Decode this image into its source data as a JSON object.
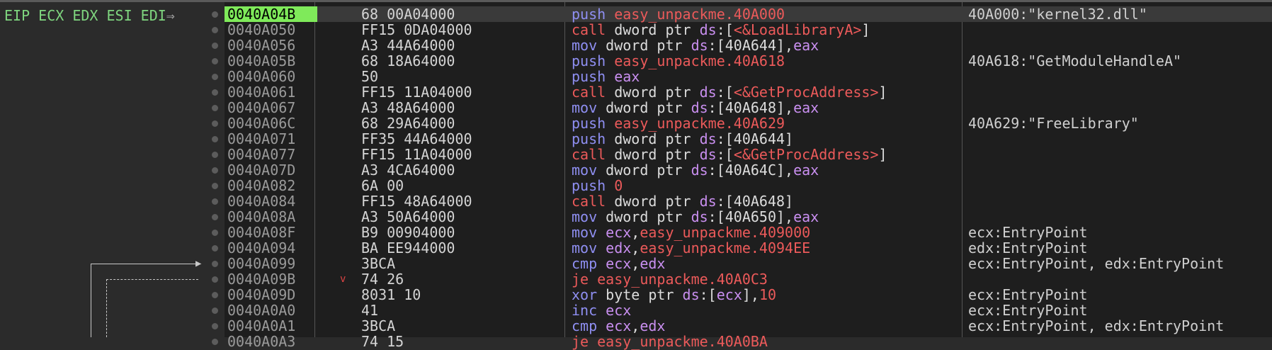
{
  "registers_label": "EIP ECX EDX ESI EDI",
  "eip_arrow": "⇒",
  "rows": [
    {
      "addr": "0040A04B",
      "bytes": "68 00A04000",
      "asm": [
        [
          "push",
          "blue"
        ],
        [
          " ",
          ""
        ],
        [
          "easy_unpackme.40A000",
          "red"
        ]
      ],
      "comment": "40A000:\"kernel32.dll\"",
      "selected": true
    },
    {
      "addr": "0040A050",
      "bytes": "FF15 0DA04000",
      "asm": [
        [
          "call",
          "call"
        ],
        [
          " dword ptr ",
          ""
        ],
        [
          "ds",
          "reg"
        ],
        [
          ":[",
          ""
        ],
        [
          "<&LoadLibraryA>",
          "red"
        ],
        [
          "]",
          ""
        ]
      ],
      "comment": ""
    },
    {
      "addr": "0040A056",
      "bytes": "A3 44A64000",
      "asm": [
        [
          "mov",
          "blue"
        ],
        [
          " dword ptr ",
          ""
        ],
        [
          "ds",
          "reg"
        ],
        [
          ":[40A644],",
          ""
        ],
        [
          "eax",
          "reg"
        ]
      ],
      "comment": ""
    },
    {
      "addr": "0040A05B",
      "bytes": "68 18A64000",
      "asm": [
        [
          "push",
          "blue"
        ],
        [
          " ",
          ""
        ],
        [
          "easy_unpackme.40A618",
          "red"
        ]
      ],
      "comment": "40A618:\"GetModuleHandleA\""
    },
    {
      "addr": "0040A060",
      "bytes": "50",
      "asm": [
        [
          "push",
          "blue"
        ],
        [
          " ",
          ""
        ],
        [
          "eax",
          "reg"
        ]
      ],
      "comment": ""
    },
    {
      "addr": "0040A061",
      "bytes": "FF15 11A04000",
      "asm": [
        [
          "call",
          "call"
        ],
        [
          " dword ptr ",
          ""
        ],
        [
          "ds",
          "reg"
        ],
        [
          ":[",
          ""
        ],
        [
          "<&GetProcAddress>",
          "red"
        ],
        [
          "]",
          ""
        ]
      ],
      "comment": ""
    },
    {
      "addr": "0040A067",
      "bytes": "A3 48A64000",
      "asm": [
        [
          "mov",
          "blue"
        ],
        [
          " dword ptr ",
          ""
        ],
        [
          "ds",
          "reg"
        ],
        [
          ":[40A648],",
          ""
        ],
        [
          "eax",
          "reg"
        ]
      ],
      "comment": ""
    },
    {
      "addr": "0040A06C",
      "bytes": "68 29A64000",
      "asm": [
        [
          "push",
          "blue"
        ],
        [
          " ",
          ""
        ],
        [
          "easy_unpackme.40A629",
          "red"
        ]
      ],
      "comment": "40A629:\"FreeLibrary\""
    },
    {
      "addr": "0040A071",
      "bytes": "FF35 44A64000",
      "asm": [
        [
          "push",
          "blue"
        ],
        [
          " dword ptr ",
          ""
        ],
        [
          "ds",
          "reg"
        ],
        [
          ":[40A644]",
          ""
        ]
      ],
      "comment": ""
    },
    {
      "addr": "0040A077",
      "bytes": "FF15 11A04000",
      "asm": [
        [
          "call",
          "call"
        ],
        [
          " dword ptr ",
          ""
        ],
        [
          "ds",
          "reg"
        ],
        [
          ":[",
          ""
        ],
        [
          "<&GetProcAddress>",
          "red"
        ],
        [
          "]",
          ""
        ]
      ],
      "comment": ""
    },
    {
      "addr": "0040A07D",
      "bytes": "A3 4CA64000",
      "asm": [
        [
          "mov",
          "blue"
        ],
        [
          " dword ptr ",
          ""
        ],
        [
          "ds",
          "reg"
        ],
        [
          ":[40A64C],",
          ""
        ],
        [
          "eax",
          "reg"
        ]
      ],
      "comment": ""
    },
    {
      "addr": "0040A082",
      "bytes": "6A 00",
      "asm": [
        [
          "push",
          "blue"
        ],
        [
          " ",
          ""
        ],
        [
          "0",
          "red"
        ]
      ],
      "comment": ""
    },
    {
      "addr": "0040A084",
      "bytes": "FF15 48A64000",
      "asm": [
        [
          "call",
          "call"
        ],
        [
          " dword ptr ",
          ""
        ],
        [
          "ds",
          "reg"
        ],
        [
          ":[40A648]",
          ""
        ]
      ],
      "comment": ""
    },
    {
      "addr": "0040A08A",
      "bytes": "A3 50A64000",
      "asm": [
        [
          "mov",
          "blue"
        ],
        [
          " dword ptr ",
          ""
        ],
        [
          "ds",
          "reg"
        ],
        [
          ":[40A650],",
          ""
        ],
        [
          "eax",
          "reg"
        ]
      ],
      "comment": ""
    },
    {
      "addr": "0040A08F",
      "bytes": "B9 00904000",
      "asm": [
        [
          "mov",
          "blue"
        ],
        [
          " ",
          ""
        ],
        [
          "ecx",
          "reg"
        ],
        [
          ",",
          ""
        ],
        [
          "easy_unpackme.409000",
          "red"
        ]
      ],
      "comment": "ecx:EntryPoint"
    },
    {
      "addr": "0040A094",
      "bytes": "BA EE944000",
      "asm": [
        [
          "mov",
          "blue"
        ],
        [
          " ",
          ""
        ],
        [
          "edx",
          "reg"
        ],
        [
          ",",
          ""
        ],
        [
          "easy_unpackme.4094EE",
          "red"
        ]
      ],
      "comment": "edx:EntryPoint"
    },
    {
      "addr": "0040A099",
      "bytes": "3BCA",
      "asm": [
        [
          "cmp",
          "blue"
        ],
        [
          " ",
          ""
        ],
        [
          "ecx",
          "reg"
        ],
        [
          ",",
          ""
        ],
        [
          "edx",
          "reg"
        ]
      ],
      "comment": "ecx:EntryPoint, edx:EntryPoint"
    },
    {
      "addr": "0040A09B",
      "bytes": "74 26",
      "asm": [
        [
          "je",
          "red"
        ],
        [
          " ",
          ""
        ],
        [
          "easy_unpackme.40A0C3",
          "red"
        ]
      ],
      "comment": "",
      "jump": "v"
    },
    {
      "addr": "0040A09D",
      "bytes": "8031 10",
      "asm": [
        [
          "xor",
          "blue"
        ],
        [
          " byte ptr ",
          ""
        ],
        [
          "ds",
          "reg"
        ],
        [
          ":[",
          ""
        ],
        [
          "ecx",
          "reg"
        ],
        [
          "],",
          ""
        ],
        [
          "10",
          "red"
        ]
      ],
      "comment": "ecx:EntryPoint"
    },
    {
      "addr": "0040A0A0",
      "bytes": "41",
      "asm": [
        [
          "inc",
          "blue"
        ],
        [
          " ",
          ""
        ],
        [
          "ecx",
          "reg"
        ]
      ],
      "comment": "ecx:EntryPoint"
    },
    {
      "addr": "0040A0A1",
      "bytes": "3BCA",
      "asm": [
        [
          "cmp",
          "blue"
        ],
        [
          " ",
          ""
        ],
        [
          "ecx",
          "reg"
        ],
        [
          ",",
          ""
        ],
        [
          "edx",
          "reg"
        ]
      ],
      "comment": "ecx:EntryPoint, edx:EntryPoint"
    },
    {
      "addr": "0040A0A3",
      "bytes": "74 15",
      "asm": [
        [
          "je",
          "red"
        ],
        [
          " ",
          ""
        ],
        [
          "easy_unpackme.40A0BA",
          "red"
        ]
      ],
      "comment": ""
    }
  ]
}
